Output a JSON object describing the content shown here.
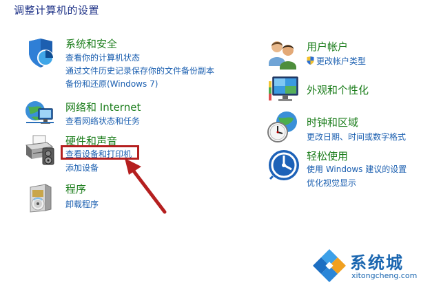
{
  "page_title": "调整计算机的设置",
  "left_categories": [
    {
      "title": "系统和安全",
      "icon": "shield-icon",
      "links": [
        "查看你的计算机状态",
        "通过文件历史记录保存你的文件备份副本",
        "备份和还原(Windows 7)"
      ]
    },
    {
      "title": "网络和 Internet",
      "icon": "network-globe-icon",
      "links": [
        "查看网络状态和任务"
      ]
    },
    {
      "title": "硬件和声音",
      "icon": "printer-icon",
      "links": [
        "查看设备和打印机",
        "添加设备"
      ]
    },
    {
      "title": "程序",
      "icon": "programs-icon",
      "links": [
        "卸载程序"
      ]
    }
  ],
  "right_categories": [
    {
      "title": "用户帐户",
      "icon": "users-icon",
      "links": [
        "更改帐户类型"
      ]
    },
    {
      "title": "外观和个性化",
      "icon": "monitor-personalize-icon",
      "links": []
    },
    {
      "title": "时钟和区域",
      "icon": "clock-globe-icon",
      "links": [
        "更改日期、时间或数字格式"
      ]
    },
    {
      "title": "轻松使用",
      "icon": "ease-of-access-icon",
      "links": [
        "使用 Windows 建议的设置",
        "优化视觉显示"
      ]
    }
  ],
  "annotation": {
    "color": "#b51f1f",
    "target": "查看设备和打印机"
  },
  "watermark": {
    "name": "系统城",
    "url": "xitongcheng.com"
  },
  "colors": {
    "title": "#1b7d1b",
    "link": "#1b5fb0",
    "heading": "#1e3287"
  }
}
